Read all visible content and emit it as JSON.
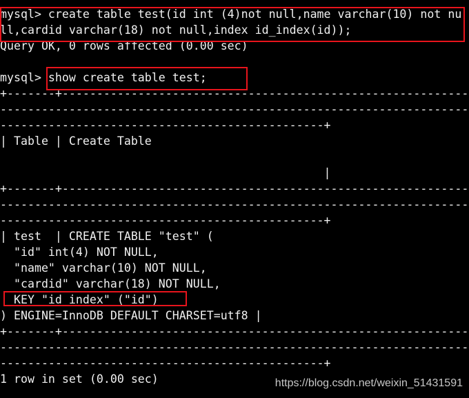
{
  "terminal": {
    "lines": [
      "mysql> create table test(id int (4)not null,name varchar(10) not nu",
      "ll,cardid varchar(18) not null,index id_index(id));",
      "Query OK, 0 rows affected (0.00 sec)",
      "",
      "mysql> show create table test;",
      "+-------+------------------------------------------------------------",
      "--------------------------------------------------------------------",
      "-----------------------------------------------+",
      "| Table | Create Table",
      "",
      "                                               |",
      "+-------+------------------------------------------------------------",
      "--------------------------------------------------------------------",
      "-----------------------------------------------+",
      "| test  | CREATE TABLE \"test\" (",
      "  \"id\" int(4) NOT NULL,",
      "  \"name\" varchar(10) NOT NULL,",
      "  \"cardid\" varchar(18) NOT NULL,",
      "  KEY \"id index\" (\"id\")",
      ") ENGINE=InnoDB DEFAULT CHARSET=utf8 |",
      "+-------+------------------------------------------------------------",
      "--------------------------------------------------------------------",
      "-----------------------------------------------+",
      "1 row in set (0.00 sec)"
    ]
  },
  "watermark": "https://blog.csdn.net/weixin_51431591",
  "colors": {
    "background": "#000000",
    "text": "#f0f0f0",
    "highlight_box": "#e8141c"
  }
}
